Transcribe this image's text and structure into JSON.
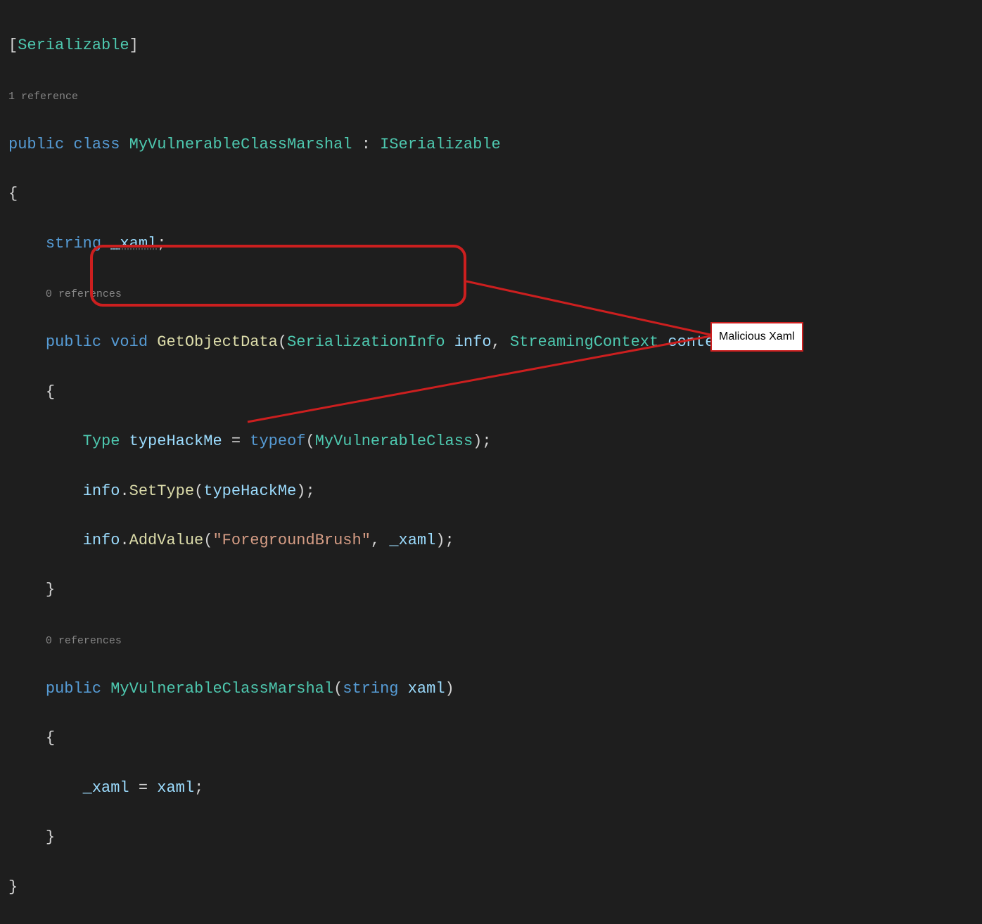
{
  "code": {
    "attr_open": "[",
    "attr_name": "Serializable",
    "attr_close": "]",
    "refcount1": "1 reference",
    "refcount0a": "0 references",
    "refcount0b": "0 references",
    "kw_public": "public",
    "kw_class": "class",
    "kw_void": "void",
    "kw_string": "string",
    "kw_typeof": "typeof",
    "class_name": "MyVulnerableClassMarshal",
    "interface_name": "ISerializable",
    "field_name": "_xaml",
    "method_getobjdata": "GetObjectData",
    "type_serinfo": "SerializationInfo",
    "param_info": "info",
    "type_streamctx": "StreamingContext",
    "param_context": "context",
    "type_type": "Type",
    "local_typehackme": "typeHackMe",
    "type_vulnclass": "MyVulnerableClass",
    "method_settype": "SetType",
    "method_addvalue": "AddValue",
    "string_fgbrush": "\"ForegroundBrush\"",
    "param_xaml": "xaml",
    "assign_eq": " = ",
    "colon_sep": " : ",
    "comma_sp": ", ",
    "semi": ";",
    "lparen": "(",
    "rparen": ")",
    "lbrace": "{",
    "rbrace": "}",
    "dot": "."
  },
  "annotation": {
    "label": "Malicious Xaml"
  }
}
